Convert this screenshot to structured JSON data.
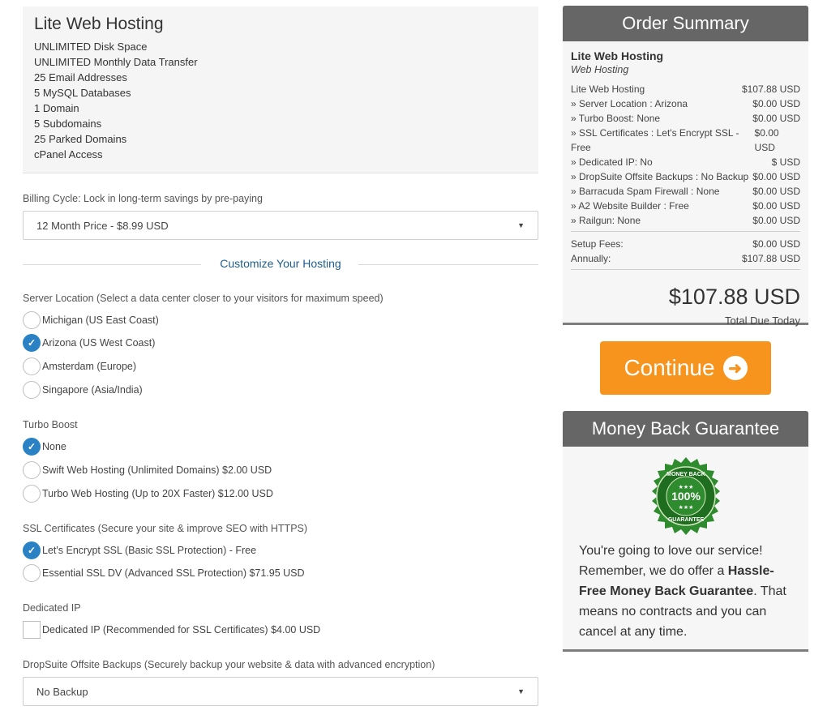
{
  "product": {
    "title": "Lite Web Hosting",
    "features": [
      "UNLIMITED Disk Space",
      "UNLIMITED Monthly Data Transfer",
      "25 Email Addresses",
      "5 MySQL Databases",
      "1 Domain",
      "5 Subdomains",
      "25 Parked Domains",
      "cPanel Access"
    ]
  },
  "billing": {
    "label": "Billing Cycle: Lock in long-term savings by pre-paying",
    "selected": "12 Month Price - $8.99 USD",
    "arrow": "▼"
  },
  "customize_title": "Customize Your Hosting",
  "server_location": {
    "label": "Server Location (Select a data center closer to your visitors for maximum speed)",
    "options": [
      "Michigan (US East Coast)",
      "Arizona (US West Coast)",
      "Amsterdam (Europe)",
      "Singapore (Asia/India)"
    ],
    "selected_index": 1
  },
  "turbo_boost": {
    "label": "Turbo Boost",
    "options": [
      "None",
      "Swift Web Hosting (Unlimited Domains) $2.00 USD",
      "Turbo Web Hosting (Up to 20X Faster) $12.00 USD"
    ],
    "selected_index": 0
  },
  "ssl": {
    "label": "SSL Certificates (Secure your site & improve SEO with HTTPS)",
    "options": [
      "Let's Encrypt SSL (Basic SSL Protection) - Free",
      "Essential SSL DV (Advanced SSL Protection) $71.95 USD"
    ],
    "selected_index": 0
  },
  "dedicated_ip": {
    "label": "Dedicated IP",
    "option": "Dedicated IP (Recommended for SSL Certificates) $4.00 USD",
    "checked": false
  },
  "dropsuite": {
    "label": "DropSuite Offsite Backups (Securely backup your website & data with advanced encryption)",
    "selected": "No Backup",
    "arrow": "▼"
  },
  "order_summary": {
    "title": "Order Summary",
    "product": "Lite Web Hosting",
    "group": "Web Hosting",
    "lines": [
      {
        "name": "Lite Web Hosting",
        "price": "$107.88 USD"
      },
      {
        "name": "» Server Location : Arizona",
        "price": "$0.00 USD"
      },
      {
        "name": "» Turbo Boost: None",
        "price": "$0.00 USD"
      },
      {
        "name": "» SSL Certificates : Let's Encrypt SSL - Free",
        "price": "$0.00 USD"
      },
      {
        "name": "» Dedicated IP: No",
        "price": "$ USD"
      },
      {
        "name": "» DropSuite Offsite Backups : No Backup",
        "price": "$0.00 USD"
      },
      {
        "name": "» Barracuda Spam Firewall : None",
        "price": "$0.00 USD"
      },
      {
        "name": "» A2 Website Builder : Free",
        "price": "$0.00 USD"
      },
      {
        "name": "» Railgun: None",
        "price": "$0.00 USD"
      }
    ],
    "setup_label": "Setup Fees:",
    "setup_value": "$0.00 USD",
    "annual_label": "Annually:",
    "annual_value": "$107.88 USD",
    "total": "$107.88 USD",
    "total_label": "Total Due Today"
  },
  "continue": {
    "label": "Continue",
    "icon": "arrow-circle-right-icon",
    "color": "#f7941d"
  },
  "guarantee": {
    "title": "Money Back Guarantee",
    "seal_text_top": "MONEY BACK",
    "seal_text_mid": "100%",
    "seal_text_bottom": "GUARANTEE",
    "text_1": "You're going to love our service! Remember, we do offer a ",
    "text_bold": "Hassle-Free Money Back Guarantee",
    "text_2": ". That means no contracts and you can cancel at any time."
  },
  "colors": {
    "accent_blue": "#2a82c4",
    "header_gray": "#666666",
    "seal_green": "#2e8b2e"
  }
}
